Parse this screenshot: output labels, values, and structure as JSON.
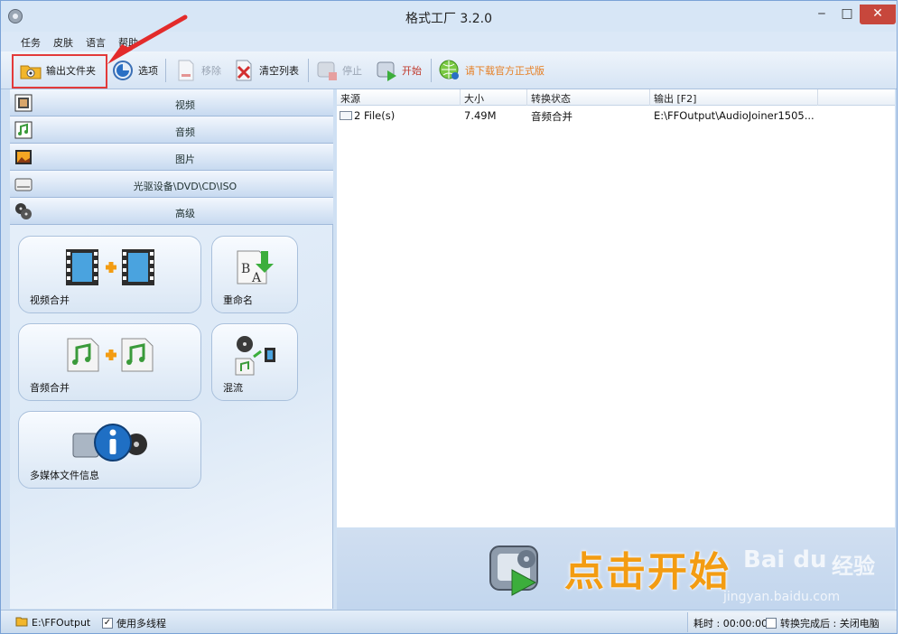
{
  "window": {
    "title": "格式工厂 3.2.0",
    "min": "‒",
    "max": "□",
    "close": "✕"
  },
  "menu": [
    "任务",
    "皮肤",
    "语言",
    "帮助"
  ],
  "toolbar": {
    "output_folder": "输出文件夹",
    "options": "选项",
    "remove": "移除",
    "clear_list": "清空列表",
    "stop": "停止",
    "start": "开始",
    "download_official": "请下载官方正式版"
  },
  "categories": [
    "视频",
    "音频",
    "图片",
    "光驱设备\\DVD\\CD\\ISO",
    "高级"
  ],
  "tiles": {
    "video_merge": "视频合并",
    "rename": "重命名",
    "audio_merge": "音频合并",
    "mux": "混流",
    "media_info": "多媒体文件信息"
  },
  "list": {
    "headers": [
      "来源",
      "大小",
      "转换状态",
      "输出 [F2]"
    ],
    "rows": [
      {
        "source": "2 File(s)",
        "size": "7.49M",
        "status": "音频合并",
        "output": "E:\\FFOutput\\AudioJoiner1505..."
      }
    ]
  },
  "start_banner": "点击开始",
  "watermark": {
    "logo": "Bai du",
    "jingyan": "经验",
    "url": "jingyan.baidu.com"
  },
  "status": {
    "output_path": "E:\\FFOutput",
    "multithread_label": "使用多线程",
    "multithread_checked": "✓",
    "elapsed": "耗时 : 00:00:00",
    "after_done_label": "转换完成后 : 关闭电脑"
  },
  "colors": {
    "highlight": "#e33a3a",
    "start_text": "#f39c12",
    "accent_blue": "#2a6fc4"
  }
}
